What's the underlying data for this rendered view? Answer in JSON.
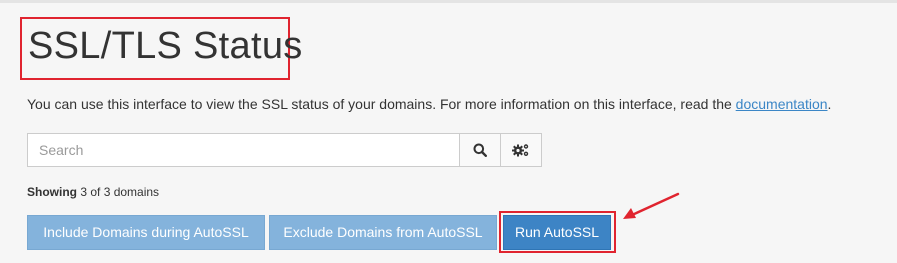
{
  "page": {
    "title": "SSL/TLS Status",
    "description_prefix": "You can use this interface to view the SSL status of your domains. For more information on this interface, read the ",
    "description_link": "documentation",
    "description_suffix": "."
  },
  "search": {
    "placeholder": "Search",
    "value": "",
    "search_icon": "search-icon",
    "settings_icon": "gears-icon"
  },
  "showing": {
    "label": "Showing",
    "text": "3 of 3 domains"
  },
  "actions": {
    "include_label": "Include Domains during AutoSSL",
    "exclude_label": "Exclude Domains from AutoSSL",
    "run_label": "Run AutoSSL"
  },
  "colors": {
    "link": "#3b86c6",
    "primary_button": "#3d84c5",
    "light_button": "#84b3dc",
    "annotation": "#e0242f"
  }
}
